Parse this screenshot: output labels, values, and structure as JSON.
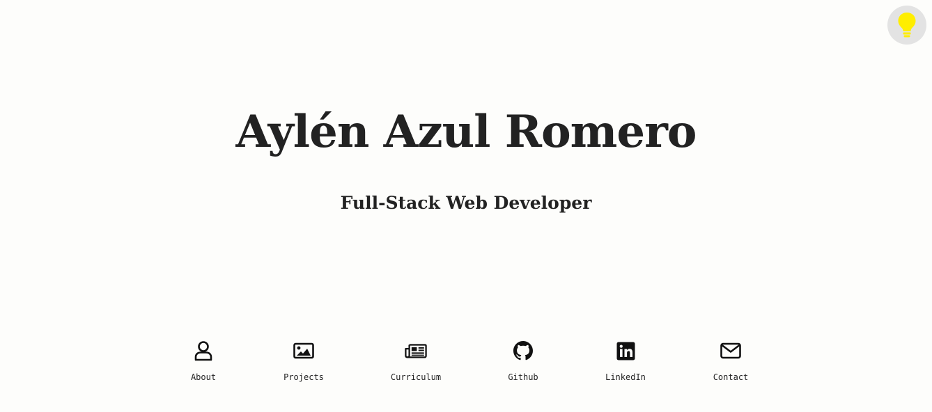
{
  "theme_toggle": {
    "icon": "lightbulb-icon",
    "color": "#ffee00"
  },
  "hero": {
    "name": "Aylén Azul Romero",
    "role": "Full-Stack Web Developer"
  },
  "nav": {
    "items": [
      {
        "label": "About",
        "icon": "user-icon"
      },
      {
        "label": "Projects",
        "icon": "image-icon"
      },
      {
        "label": "Curriculum",
        "icon": "newspaper-icon"
      },
      {
        "label": "Github",
        "icon": "github-icon"
      },
      {
        "label": "LinkedIn",
        "icon": "linkedin-icon"
      },
      {
        "label": "Contact",
        "icon": "envelope-icon"
      }
    ]
  }
}
